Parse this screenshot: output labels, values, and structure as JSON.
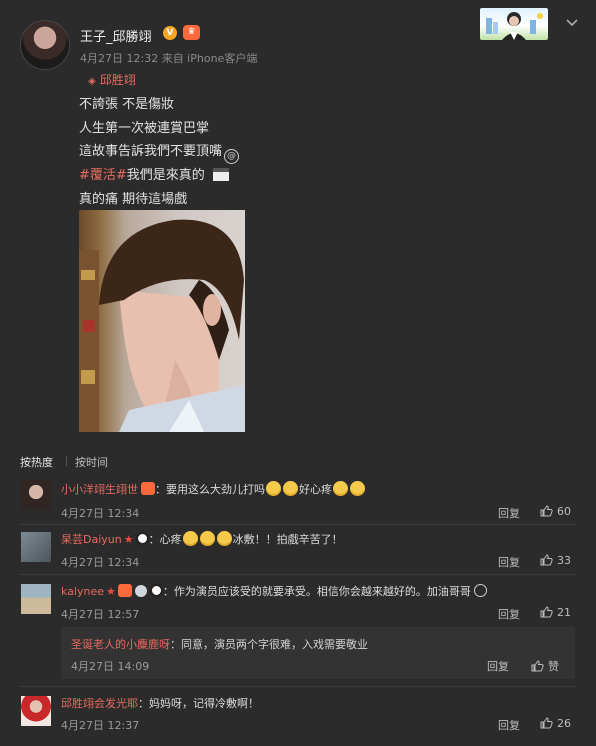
{
  "post": {
    "user_name": "王子_邱勝翊",
    "verified_badge": "V",
    "meta": "4月27日 12:32 来自 iPhone客户端",
    "topic_tag": "邱胜翊",
    "lines": [
      "不誇張 不是傷妝",
      "人生第一次被連賞巴掌",
      "這故事告訴我們不要頂嘴"
    ],
    "hashtag": "#覆活#",
    "hashtag_rest": "我們是來真的",
    "last_line": "真的痛 期待這場戲",
    "icons": [
      "gem-icon",
      "dizzy-emoji-icon",
      "clapperboard-icon",
      "chevron-down-icon"
    ]
  },
  "comments": {
    "sort_hot": "按热度",
    "sort_time": "按时间",
    "reply_label": "回复",
    "like_word": "赞",
    "items": [
      {
        "name": "小小洋翊生翊世",
        "text": "：要用这么大劲儿打吗",
        "text_after": "好心疼",
        "time": "4月27日 12:34",
        "likes": "60"
      },
      {
        "name": "杲芸Daiyun",
        "text": "：心疼",
        "text_after": "冰敷！！拍戲辛苦了！",
        "time": "4月27日 12:34",
        "likes": "33"
      },
      {
        "name": "kalynee",
        "text": "：作为演员应该受的就要承受。相信你会越来越好的。加油哥哥",
        "time": "4月27日 12:57",
        "likes": "21"
      },
      {
        "name": "邱胜翊会发光耶",
        "text": "：妈妈呀，记得冷敷啊！",
        "time": "4月27日 12:37",
        "likes": "26"
      }
    ],
    "sub_reply": {
      "name": "圣诞老人的小麋鹿呀",
      "text": "：同意，演员两个字很难，入戏需要敬业",
      "time": "4月27日 14:09"
    }
  },
  "colors": {
    "background": "#2b2b2b",
    "name_accent": "#e86b5f",
    "sub_box": "#333333"
  }
}
